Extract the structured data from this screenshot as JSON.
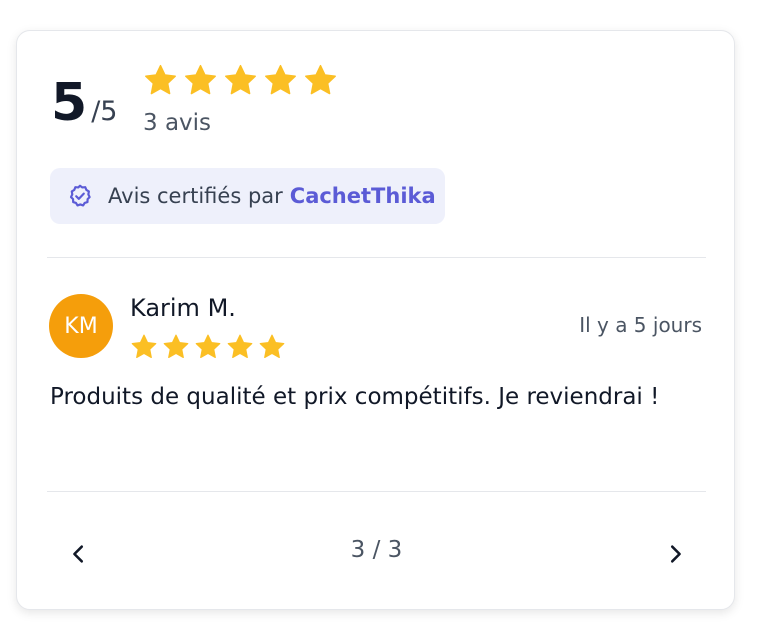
{
  "summary": {
    "score": "5",
    "denominator": "/5",
    "stars": 5,
    "review_count": "3 avis",
    "star_color": "#fbbf24"
  },
  "certification": {
    "text": "Avis certifiés par",
    "brand": "CachetThika",
    "icon": "verified-badge-icon",
    "brand_color": "#5b5bd6"
  },
  "review": {
    "initials": "KM",
    "avatar_color": "#f59e0b",
    "name": "Karim M.",
    "stars": 5,
    "date": "Il y a 5 jours",
    "text": "Produits de qualité et prix compétitifs. Je reviendrai !"
  },
  "pagination": {
    "current": "3 / 3",
    "prev_icon": "chevron-left-icon",
    "next_icon": "chevron-right-icon"
  }
}
